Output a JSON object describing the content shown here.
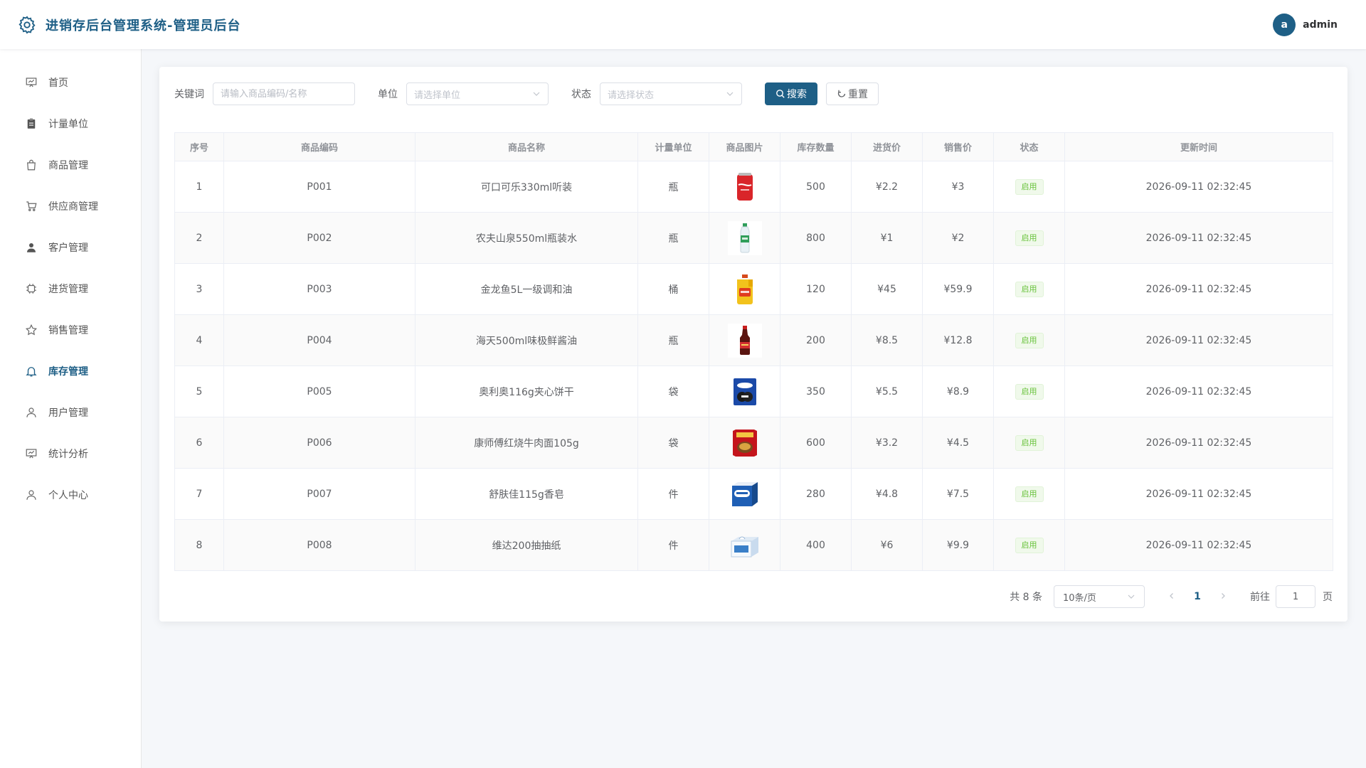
{
  "header": {
    "title": "进销存后台管理系统-管理员后台",
    "avatar_letter": "a",
    "username": "admin"
  },
  "sidebar": {
    "items": [
      {
        "label": "首页",
        "icon": "dashboard-icon"
      },
      {
        "label": "计量单位",
        "icon": "clipboard-icon"
      },
      {
        "label": "商品管理",
        "icon": "shopping-bag-icon"
      },
      {
        "label": "供应商管理",
        "icon": "cart-icon"
      },
      {
        "label": "客户管理",
        "icon": "user-solid-icon"
      },
      {
        "label": "进货管理",
        "icon": "cpu-icon"
      },
      {
        "label": "销售管理",
        "icon": "star-icon"
      },
      {
        "label": "库存管理",
        "icon": "bell-icon",
        "active": true
      },
      {
        "label": "用户管理",
        "icon": "user-icon"
      },
      {
        "label": "统计分析",
        "icon": "chart-board-icon"
      },
      {
        "label": "个人中心",
        "icon": "user-icon"
      }
    ]
  },
  "filters": {
    "keyword_label": "关键词",
    "keyword_placeholder": "请输入商品编码/名称",
    "unit_label": "单位",
    "unit_placeholder": "请选择单位",
    "status_label": "状态",
    "status_placeholder": "请选择状态",
    "search_label": "搜索",
    "reset_label": "重置"
  },
  "table": {
    "columns": [
      "序号",
      "商品编码",
      "商品名称",
      "计量单位",
      "商品图片",
      "库存数量",
      "进货价",
      "销售价",
      "状态",
      "更新时间"
    ],
    "rows": [
      {
        "no": "1",
        "code": "P001",
        "name": "可口可乐330ml听装",
        "unit": "瓶",
        "image": "cola-can",
        "qty": "500",
        "cost": "¥2.2",
        "price": "¥3",
        "status": "启用",
        "updated": "2026-09-11 02:32:45"
      },
      {
        "no": "2",
        "code": "P002",
        "name": "农夫山泉550ml瓶装水",
        "unit": "瓶",
        "image": "water-bottle",
        "qty": "800",
        "cost": "¥1",
        "price": "¥2",
        "status": "启用",
        "updated": "2026-09-11 02:32:45"
      },
      {
        "no": "3",
        "code": "P003",
        "name": "金龙鱼5L一级调和油",
        "unit": "桶",
        "image": "oil-jug",
        "qty": "120",
        "cost": "¥45",
        "price": "¥59.9",
        "status": "启用",
        "updated": "2026-09-11 02:32:45"
      },
      {
        "no": "4",
        "code": "P004",
        "name": "海天500ml味极鲜酱油",
        "unit": "瓶",
        "image": "soy-sauce",
        "qty": "200",
        "cost": "¥8.5",
        "price": "¥12.8",
        "status": "启用",
        "updated": "2026-09-11 02:32:45"
      },
      {
        "no": "5",
        "code": "P005",
        "name": "奥利奥116g夹心饼干",
        "unit": "袋",
        "image": "oreo-pack",
        "qty": "350",
        "cost": "¥5.5",
        "price": "¥8.9",
        "status": "启用",
        "updated": "2026-09-11 02:32:45"
      },
      {
        "no": "6",
        "code": "P006",
        "name": "康师傅红烧牛肉面105g",
        "unit": "袋",
        "image": "noodle-pack",
        "qty": "600",
        "cost": "¥3.2",
        "price": "¥4.5",
        "status": "启用",
        "updated": "2026-09-11 02:32:45"
      },
      {
        "no": "7",
        "code": "P007",
        "name": "舒肤佳115g香皂",
        "unit": "件",
        "image": "soap-box",
        "qty": "280",
        "cost": "¥4.8",
        "price": "¥7.5",
        "status": "启用",
        "updated": "2026-09-11 02:32:45"
      },
      {
        "no": "8",
        "code": "P008",
        "name": "维达200抽抽纸",
        "unit": "件",
        "image": "tissue-box",
        "qty": "400",
        "cost": "¥6",
        "price": "¥9.9",
        "status": "启用",
        "updated": "2026-09-11 02:32:45"
      }
    ]
  },
  "pagination": {
    "total": "共 8 条",
    "page_size": "10条/页",
    "current": "1",
    "goto_label": "前往",
    "goto_value": "1",
    "page_suffix": "页"
  },
  "colors": {
    "primary": "#1e5f86",
    "success": "#67c23a"
  }
}
